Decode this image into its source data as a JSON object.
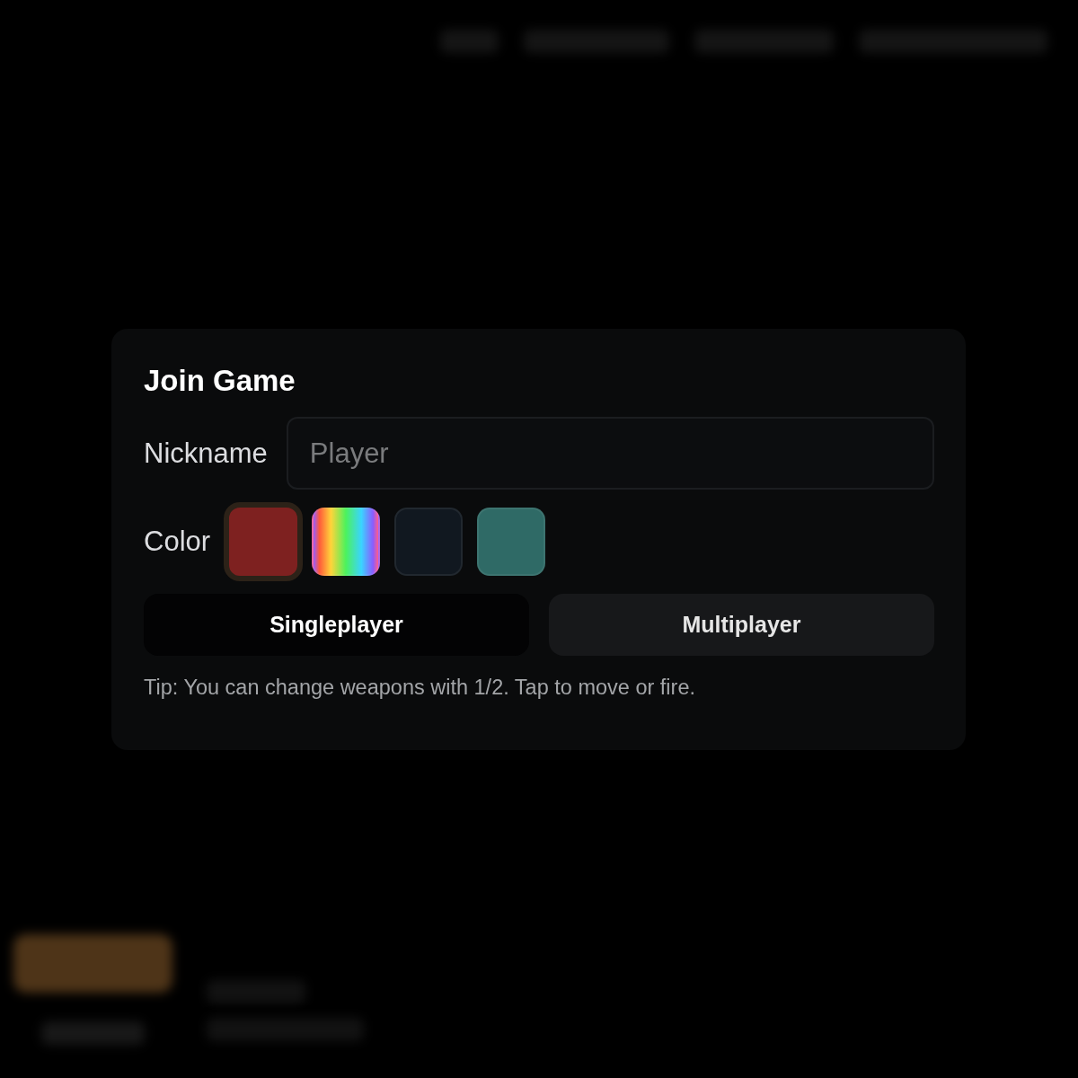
{
  "dialog": {
    "title": "Join Game",
    "nickname": {
      "label": "Nickname",
      "placeholder": "Player"
    },
    "color": {
      "label": "Color",
      "swatches": [
        {
          "kind": "solid",
          "color": "#7e2120",
          "selected": true
        },
        {
          "kind": "rainbow",
          "selected": false
        },
        {
          "kind": "solid",
          "color": "#111820",
          "selected": false
        },
        {
          "kind": "solid",
          "color": "#2f6a66",
          "selected": false
        }
      ]
    },
    "modes": [
      {
        "label": "Singleplayer",
        "selected": true
      },
      {
        "label": "Multiplayer",
        "selected": false
      }
    ],
    "tip": "Tip: You can change weapons with 1/2. Tap to move or fire."
  }
}
